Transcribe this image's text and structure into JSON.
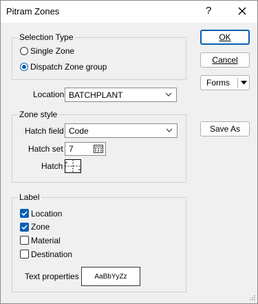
{
  "window": {
    "title": "Pitram Zones",
    "help_glyph": "?",
    "close_glyph": "✕"
  },
  "buttons": {
    "ok": "OK",
    "cancel": "Cancel",
    "forms": "Forms",
    "save_as": "Save As"
  },
  "selection_type": {
    "legend": "Selection Type",
    "options": [
      {
        "label": "Single Zone",
        "selected": false
      },
      {
        "label": "Dispatch Zone group",
        "selected": true
      }
    ]
  },
  "location": {
    "label": "Location",
    "value": "BATCHPLANT"
  },
  "zone_style": {
    "legend": "Zone style",
    "hatch_field_label": "Hatch field",
    "hatch_field_value": "Code",
    "hatch_set_label": "Hatch set",
    "hatch_set_value": "7",
    "hatch_label": "Hatch"
  },
  "label_group": {
    "legend": "Label",
    "checkboxes": [
      {
        "label": "Location",
        "checked": true
      },
      {
        "label": "Zone",
        "checked": true
      },
      {
        "label": "Material",
        "checked": false
      },
      {
        "label": "Destination",
        "checked": false
      }
    ],
    "text_properties_label": "Text properties",
    "text_properties_sample": "AaBbYyZz"
  },
  "colors": {
    "accent": "#0a5fb4",
    "background": "#f0f0f0",
    "titlebar": "#ffffff"
  }
}
